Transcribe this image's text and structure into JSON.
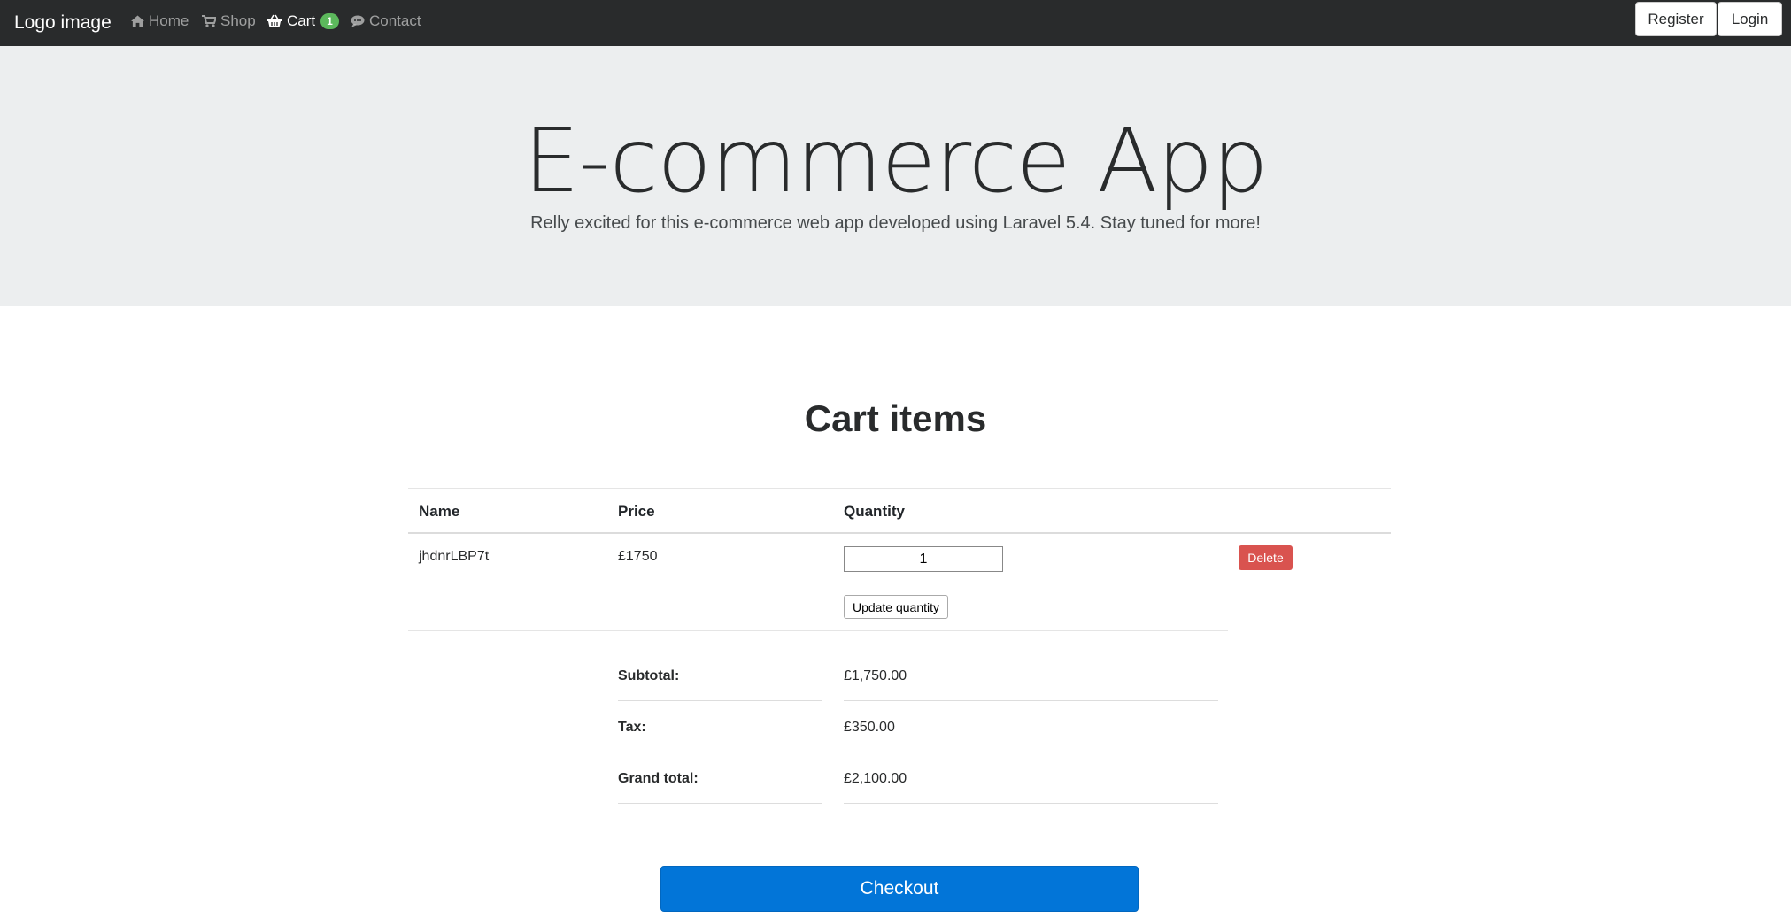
{
  "navbar": {
    "brand": "Logo image",
    "items": [
      {
        "label": "Home",
        "icon": "home-icon"
      },
      {
        "label": "Shop",
        "icon": "shopping-cart-icon"
      },
      {
        "label": "Cart",
        "icon": "basket-icon",
        "badge": "1",
        "active": true
      },
      {
        "label": "Contact",
        "icon": "comment-icon"
      }
    ],
    "register_label": "Register",
    "login_label": "Login"
  },
  "jumbotron": {
    "title": "E-commerce App",
    "lead": "Relly excited for this e-commerce web app developed using Laravel 5.4. Stay tuned for more!"
  },
  "cart": {
    "title": "Cart items",
    "columns": [
      "Name",
      "Price",
      "Quantity"
    ],
    "items": [
      {
        "name": "jhdnrLBP7t",
        "price": "£1750",
        "quantity": "1",
        "update_label": "Update quantity",
        "delete_label": "Delete"
      }
    ],
    "summary": [
      {
        "label": "Subtotal:",
        "value": "£1,750.00"
      },
      {
        "label": "Tax:",
        "value": "£350.00"
      },
      {
        "label": "Grand total:",
        "value": "£2,100.00"
      }
    ],
    "checkout_label": "Checkout"
  },
  "colors": {
    "navbar_bg": "#292b2c",
    "jumbotron_bg": "#eceeef",
    "badge": "#5cb85c",
    "danger": "#d9534f",
    "primary": "#0275d8"
  }
}
